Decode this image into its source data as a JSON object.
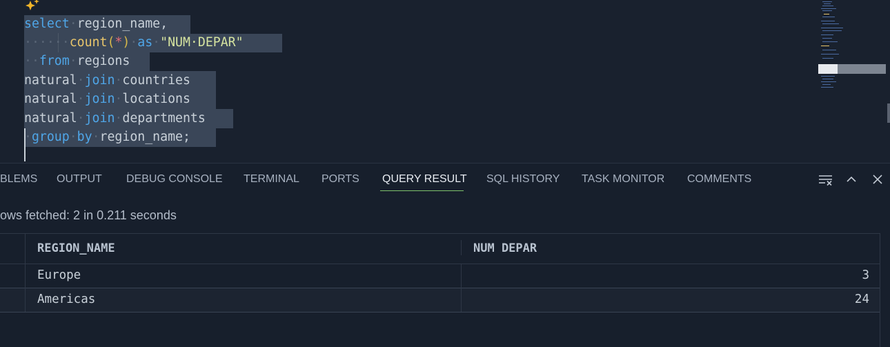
{
  "editor": {
    "lines": [
      {
        "parts": [
          [
            "kw",
            "select"
          ],
          [
            "dot",
            "·"
          ],
          [
            "",
            "region_name,"
          ]
        ]
      },
      {
        "parts": [
          [
            "dot",
            "······"
          ],
          [
            "fn",
            "count"
          ],
          [
            "paren",
            "("
          ],
          [
            "star",
            "*"
          ],
          [
            "paren",
            ")"
          ],
          [
            "dot",
            "·"
          ],
          [
            "kw",
            "as"
          ],
          [
            "dot",
            "·"
          ],
          [
            "str",
            "\"NUM·DEPAR\""
          ]
        ]
      },
      {
        "parts": [
          [
            "dot",
            "··"
          ],
          [
            "kw",
            "from"
          ],
          [
            "dot",
            "·"
          ],
          [
            "",
            "regions"
          ]
        ]
      },
      {
        "parts": [
          [
            "",
            "natural"
          ],
          [
            "dot",
            "·"
          ],
          [
            "kw",
            "join"
          ],
          [
            "dot",
            "·"
          ],
          [
            "",
            "countries"
          ]
        ]
      },
      {
        "parts": [
          [
            "",
            "natural"
          ],
          [
            "dot",
            "·"
          ],
          [
            "kw",
            "join"
          ],
          [
            "dot",
            "·"
          ],
          [
            "",
            "locations"
          ]
        ]
      },
      {
        "parts": [
          [
            "",
            "natural"
          ],
          [
            "dot",
            "·"
          ],
          [
            "kw",
            "join"
          ],
          [
            "dot",
            "·"
          ],
          [
            "",
            "departments"
          ]
        ]
      },
      {
        "parts": [
          [
            "dot",
            "·"
          ],
          [
            "kw",
            "group"
          ],
          [
            "dot",
            "·"
          ],
          [
            "kw",
            "by"
          ],
          [
            "dot",
            "·"
          ],
          [
            "",
            "region_name;"
          ]
        ]
      }
    ]
  },
  "panel": {
    "tabs": [
      {
        "id": "problems",
        "label": "BLEMS"
      },
      {
        "id": "output",
        "label": "OUTPUT"
      },
      {
        "id": "debug-console",
        "label": "DEBUG CONSOLE"
      },
      {
        "id": "terminal",
        "label": "TERMINAL"
      },
      {
        "id": "ports",
        "label": "PORTS"
      },
      {
        "id": "query-result",
        "label": "QUERY RESULT"
      },
      {
        "id": "sql-history",
        "label": "SQL HISTORY"
      },
      {
        "id": "task-monitor",
        "label": "TASK MONITOR"
      },
      {
        "id": "comments",
        "label": "COMMENTS"
      }
    ],
    "active_tab": "QUERY RESULT",
    "icons": [
      "clear-list-icon",
      "chevron-up-icon",
      "close-icon"
    ]
  },
  "query_result": {
    "status": "ows fetched: 2 in 0.211 seconds",
    "columns": [
      "REGION_NAME",
      "NUM DEPAR"
    ],
    "rows": [
      [
        "Europe",
        "3"
      ],
      [
        "Americas",
        "24"
      ]
    ]
  },
  "colors": {
    "keyword": "#4fa6e8",
    "function": "#e8c56b",
    "string": "#d6e4a0",
    "active_tab_underline": "#7fc26b",
    "selection": "#3a4658"
  }
}
